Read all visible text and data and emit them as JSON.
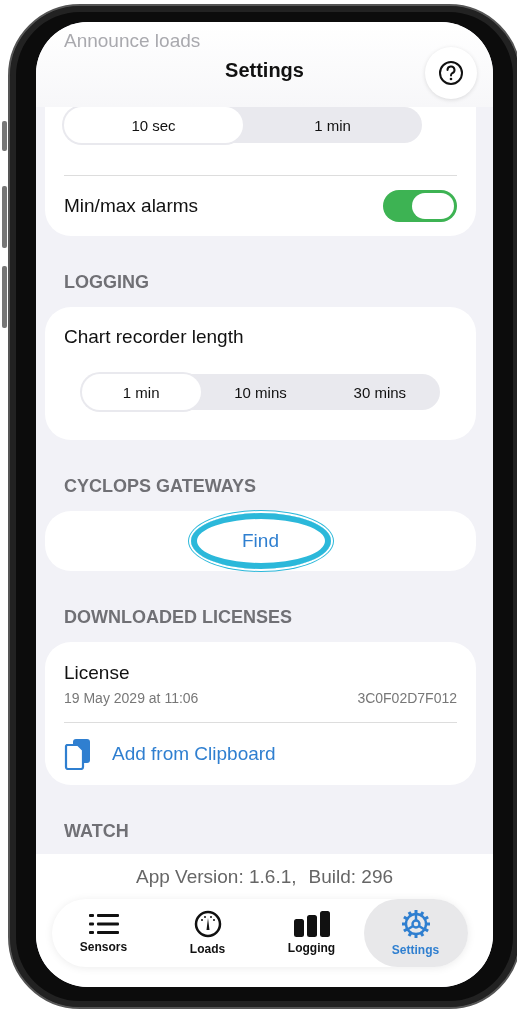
{
  "header": {
    "faded_row": "Announce loads",
    "title": "Settings"
  },
  "sections": [
    {
      "items": [
        {
          "kind": "segmented",
          "options": [
            {
              "label": "10 sec",
              "selected": true
            },
            {
              "label": "1 min",
              "selected": false
            }
          ]
        },
        {
          "kind": "toggle",
          "label": "Min/max alarms",
          "on": true
        }
      ]
    },
    {
      "heading": "LOGGING",
      "items": [
        {
          "kind": "label",
          "label": "Chart recorder length"
        },
        {
          "kind": "segmented",
          "options": [
            {
              "label": "1 min",
              "selected": true
            },
            {
              "label": "10 mins",
              "selected": false
            },
            {
              "label": "30 mins",
              "selected": false
            }
          ]
        }
      ]
    },
    {
      "heading": "CYCLOPS GATEWAYS",
      "items": [
        {
          "kind": "button",
          "label": "Find",
          "highlighted": true
        }
      ]
    },
    {
      "heading": "DOWNLOADED LICENSES",
      "items": [
        {
          "kind": "license",
          "name": "License",
          "date": "19 May 2029 at 11:06",
          "code": "3C0F02D7F012"
        },
        {
          "kind": "action",
          "label": "Add from Clipboard"
        }
      ]
    },
    {
      "heading": "WATCH"
    }
  ],
  "footer": {
    "version": "App Version: 1.6.1,",
    "build": "Build: 296"
  },
  "tabs": [
    {
      "label": "Sensors",
      "selected": false
    },
    {
      "label": "Loads",
      "selected": false
    },
    {
      "label": "Logging",
      "selected": false
    },
    {
      "label": "Settings",
      "selected": true
    }
  ]
}
